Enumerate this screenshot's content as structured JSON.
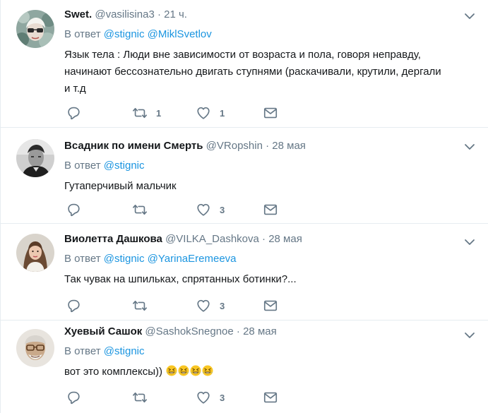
{
  "tweets": [
    {
      "fullname": "Swet.",
      "username": "@vasilisina3",
      "dot": "·",
      "time": "21 ч.",
      "replying_prefix": "В ответ",
      "mentions": [
        "@stignic",
        "@MiklSvetlov"
      ],
      "text_lines": [
        "Язык тела : Люди вне зависимости от возраста и пола, говоря неправду,",
        "начинают бессознательно двигать ступнями (раскачивали, крутили, дергали",
        "и т.д"
      ],
      "retweets": "1",
      "likes": "1"
    },
    {
      "fullname": "Всадник по имени Смерть",
      "username": "@VRopshin",
      "dot": "·",
      "time": "28 мая",
      "replying_prefix": "В ответ",
      "mentions": [
        "@stignic"
      ],
      "text": "Гутаперчивый мальчик",
      "retweets": "",
      "likes": "3"
    },
    {
      "fullname": "Виолетта Дашкова",
      "username": "@VILKA_Dashkova",
      "dot": "·",
      "time": "28 мая",
      "replying_prefix": "В ответ",
      "mentions": [
        "@stignic",
        "@YarinaEremeeva"
      ],
      "text": "Так чувак на шпильках, спрятанных ботинки?...",
      "retweets": "",
      "likes": "3"
    },
    {
      "fullname": "Хуевый Сашок",
      "username": "@SashokSnegnoe",
      "dot": "·",
      "time": "28 мая",
      "replying_prefix": "В ответ",
      "mentions": [
        "@stignic"
      ],
      "text": "вот это комплексы))",
      "emojis": [
        "rolling-on-floor-laughing-emoji",
        "rolling-on-floor-laughing-emoji",
        "rolling-on-floor-laughing-emoji",
        "rolling-on-floor-laughing-emoji"
      ],
      "retweets": "",
      "likes": "3"
    }
  ],
  "icons": {
    "reply": "reply-icon",
    "retweet": "retweet-icon",
    "like": "heart-icon",
    "dm": "envelope-icon",
    "caret": "chevron-down-icon"
  },
  "colors": {
    "link": "#1b95e0",
    "secondary": "#657786",
    "text": "#14171a",
    "divider": "#e6ecf0"
  }
}
